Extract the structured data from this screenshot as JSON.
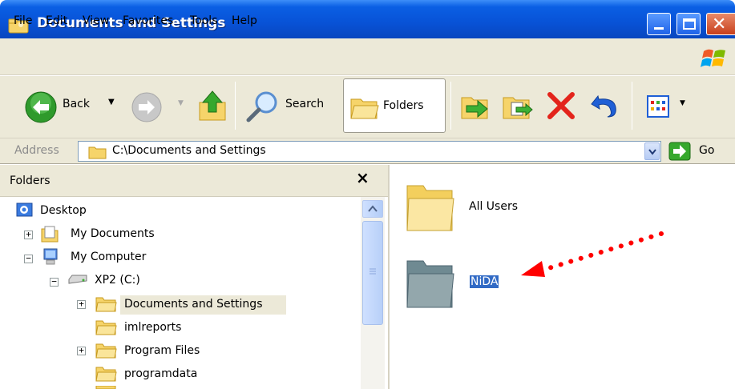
{
  "window": {
    "title": "Documents and Settings"
  },
  "menu": [
    "File",
    "Edit",
    "View",
    "Favorites",
    "Tools",
    "Help"
  ],
  "toolbar": {
    "back_label": "Back",
    "search_label": "Search",
    "folders_label": "Folders"
  },
  "address": {
    "label": "Address",
    "value": "C:\\Documents and Settings",
    "go_label": "Go"
  },
  "folders_panel": {
    "title": "Folders",
    "tree": [
      {
        "label": "Desktop"
      },
      {
        "label": "My Documents"
      },
      {
        "label": "My Computer"
      },
      {
        "label": "XP2 (C:)"
      },
      {
        "label": "Documents and Settings"
      },
      {
        "label": "imlreports"
      },
      {
        "label": "Program Files"
      },
      {
        "label": "programdata"
      }
    ]
  },
  "content": {
    "items": [
      {
        "label": "All Users",
        "selected": false
      },
      {
        "label": "NiDA",
        "selected": true
      }
    ]
  },
  "colors": {
    "titlebar": "#0852d6",
    "chrome": "#ece9d8",
    "selection": "#316ac5",
    "annotation_arrow": "#ff0000"
  }
}
